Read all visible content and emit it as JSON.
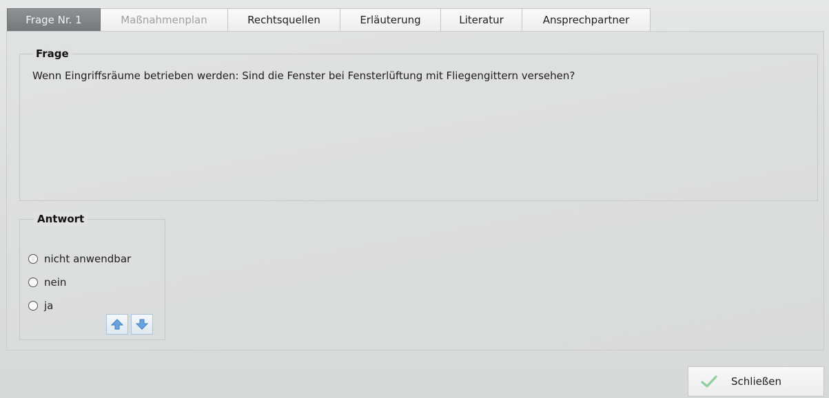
{
  "tabs": [
    {
      "label": "Frage Nr. 1",
      "state": "active"
    },
    {
      "label": "Maßnahmenplan",
      "state": "disabled"
    },
    {
      "label": "Rechtsquellen",
      "state": "normal"
    },
    {
      "label": "Erläuterung",
      "state": "normal"
    },
    {
      "label": "Literatur",
      "state": "normal"
    },
    {
      "label": "Ansprechpartner",
      "state": "normal"
    }
  ],
  "frage": {
    "title": "Frage",
    "text": "Wenn Eingriffsräume betrieben werden: Sind die Fenster bei Fensterlüftung mit Fliegengittern versehen?"
  },
  "antwort": {
    "title": "Antwort",
    "options": [
      "nicht anwendbar",
      "nein",
      "ja"
    ],
    "selected": null,
    "up_icon": "arrow-up-icon",
    "down_icon": "arrow-down-icon"
  },
  "close_button": {
    "label": "Schließen",
    "icon": "checkmark-icon"
  },
  "colors": {
    "active_tab": "#7f8386",
    "arrow_blue": "#4f8fd6",
    "check_green": "#8fcf9b"
  }
}
